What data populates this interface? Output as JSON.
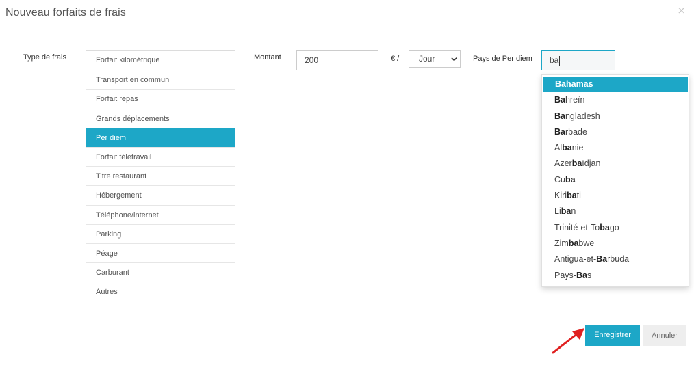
{
  "modal": {
    "title": "Nouveau forfaits de frais",
    "close_symbol": "×"
  },
  "form": {
    "type_label": "Type de frais",
    "types": [
      {
        "label": "Forfait kilométrique",
        "active": false
      },
      {
        "label": "Transport en commun",
        "active": false
      },
      {
        "label": "Forfait repas",
        "active": false
      },
      {
        "label": "Grands déplacements",
        "active": false
      },
      {
        "label": "Per diem",
        "active": true
      },
      {
        "label": "Forfait télétravail",
        "active": false
      },
      {
        "label": "Titre restaurant",
        "active": false
      },
      {
        "label": "Hébergement",
        "active": false
      },
      {
        "label": "Téléphone/internet",
        "active": false
      },
      {
        "label": "Parking",
        "active": false
      },
      {
        "label": "Péage",
        "active": false
      },
      {
        "label": "Carburant",
        "active": false
      },
      {
        "label": "Autres",
        "active": false
      }
    ],
    "montant_label": "Montant",
    "montant_value": "200",
    "currency_label": "€ /",
    "period_selected": "Jour",
    "pays_label": "Pays de Per diem",
    "pays_value": "ba"
  },
  "dropdown": {
    "query": "ba",
    "options": [
      "Bahamas",
      "Bahreïn",
      "Bangladesh",
      "Barbade",
      "Albanie",
      "Azerbaïdjan",
      "Cuba",
      "Kiribati",
      "Liban",
      "Trinité-et-Tobago",
      "Zimbabwe",
      "Antigua-et-Barbuda",
      "Pays-Bas"
    ],
    "highlighted_index": 0
  },
  "actions": {
    "save_label": "Enregistrer",
    "cancel_label": "Annuler"
  },
  "colors": {
    "accent": "#1da7c7",
    "arrow": "#e02020"
  }
}
